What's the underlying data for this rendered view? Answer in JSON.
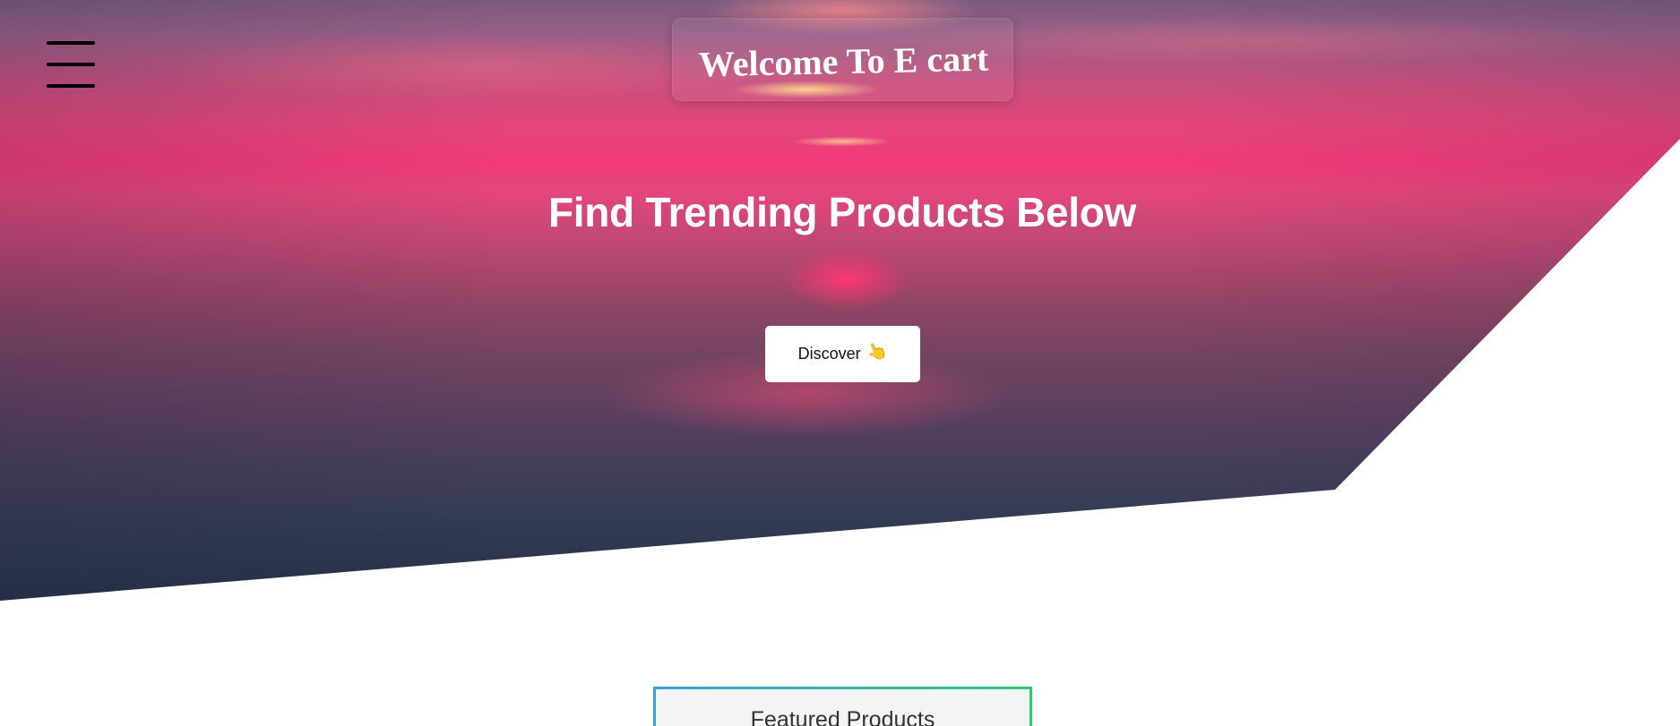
{
  "header": {
    "menu_icon": "hamburger-menu-icon",
    "welcome_title": "Welcome To E cart"
  },
  "hero": {
    "heading": "Find Trending Products Below",
    "discover_label": "Discover",
    "discover_icon_glyph": "👆",
    "discover_icon": "pointing-hand-icon",
    "accent_colors": [
      "#f13a7a",
      "#24314a"
    ]
  },
  "featured": {
    "title": "Featured Products",
    "border_colors": [
      "#3aa0d8",
      "#2ecc71"
    ]
  }
}
